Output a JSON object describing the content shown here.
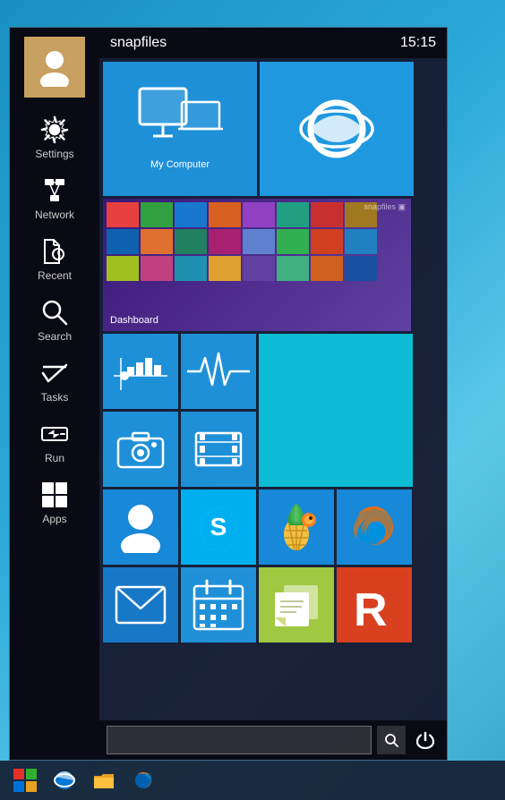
{
  "desktop": {
    "background_color": "#1a8fc1"
  },
  "header": {
    "app_name": "snapfiles",
    "time": "15:15"
  },
  "sidebar": {
    "items": [
      {
        "id": "settings",
        "label": "Settings",
        "icon": "gear"
      },
      {
        "id": "network",
        "label": "Network",
        "icon": "network"
      },
      {
        "id": "recent",
        "label": "Recent",
        "icon": "recent"
      },
      {
        "id": "search",
        "label": "Search",
        "icon": "search"
      },
      {
        "id": "tasks",
        "label": "Tasks",
        "icon": "tasks"
      },
      {
        "id": "run",
        "label": "Run",
        "icon": "run"
      },
      {
        "id": "apps",
        "label": "Apps",
        "icon": "apps"
      }
    ]
  },
  "tiles": {
    "row1": [
      {
        "id": "my-computer",
        "label": "My Computer",
        "color": "#1e90d8",
        "icon": "monitor"
      },
      {
        "id": "ie",
        "label": "",
        "color": "#1e7fd8",
        "icon": "ie"
      }
    ],
    "row2": [
      {
        "id": "dashboard",
        "label": "Dashboard",
        "color": "#3a1878",
        "icon": "screenshot"
      }
    ],
    "row3": [
      {
        "id": "stats",
        "label": "",
        "color": "#1888d8",
        "icon": "chart"
      },
      {
        "id": "heartbeat",
        "label": "",
        "color": "#1888d8",
        "icon": "heartbeat"
      },
      {
        "id": "big-blue",
        "label": "",
        "color": "#1888d8",
        "icon": ""
      }
    ],
    "row4": [
      {
        "id": "camera",
        "label": "",
        "color": "#1888d8",
        "icon": "camera"
      },
      {
        "id": "film",
        "label": "",
        "color": "#1888d8",
        "icon": "film"
      }
    ],
    "row5": [
      {
        "id": "person",
        "label": "",
        "color": "#1888d8",
        "icon": "person"
      },
      {
        "id": "skype",
        "label": "",
        "color": "#00aff0",
        "icon": "skype"
      },
      {
        "id": "pineapple",
        "label": "",
        "color": "#1888d8",
        "icon": "pineapple"
      },
      {
        "id": "firefox",
        "label": "",
        "color": "#1888d8",
        "icon": "firefox"
      }
    ],
    "row6": [
      {
        "id": "mail",
        "label": "",
        "color": "#1878c8",
        "icon": "mail"
      },
      {
        "id": "calendar",
        "label": "",
        "color": "#2090d8",
        "icon": "calendar"
      },
      {
        "id": "sticky",
        "label": "",
        "color": "#a0c840",
        "icon": "sticky"
      },
      {
        "id": "rocketdock",
        "label": "",
        "color": "#d84020",
        "icon": "r"
      }
    ]
  },
  "bottom_bar": {
    "search_placeholder": "",
    "search_icon": "search",
    "power_icon": "power"
  },
  "taskbar": {
    "buttons": [
      {
        "id": "start",
        "icon": "windows",
        "color": "#e8302a"
      },
      {
        "id": "ie",
        "icon": "ie",
        "color": "#0078d7"
      },
      {
        "id": "explorer",
        "icon": "folder",
        "color": "#e8a020"
      },
      {
        "id": "firefox",
        "icon": "firefox",
        "color": "#e87820"
      }
    ]
  }
}
